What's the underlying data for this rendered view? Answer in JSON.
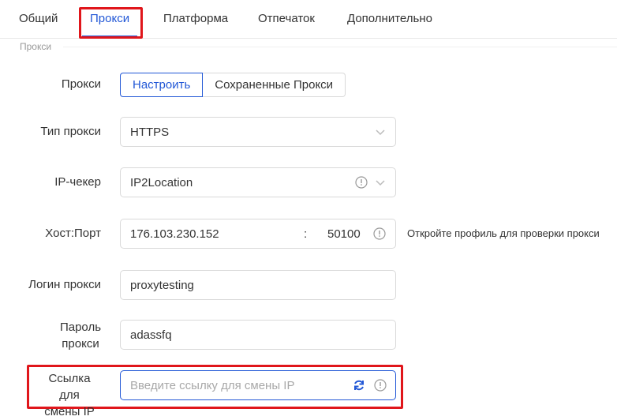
{
  "tabs": [
    {
      "label": "Общий"
    },
    {
      "label": "Прокси"
    },
    {
      "label": "Платформа"
    },
    {
      "label": "Отпечаток"
    },
    {
      "label": "Дополнительно"
    }
  ],
  "section_title": "Прокси",
  "proxy": {
    "label": "Прокси",
    "configure": "Настроить",
    "saved": "Сохраненные Прокси"
  },
  "proxy_type": {
    "label": "Тип прокси",
    "value": "HTTPS"
  },
  "ip_checker": {
    "label": "IP-чекер",
    "value": "IP2Location"
  },
  "host_port": {
    "label": "Хост:Порт",
    "host": "176.103.230.152",
    "separator": ":",
    "port": "50100",
    "hint": "Откройте профиль для проверки прокси"
  },
  "login": {
    "label": "Логин прокси",
    "value": "proxytesting"
  },
  "password": {
    "label_line1": "Пароль",
    "label_line2": "прокси",
    "value": "adassfq"
  },
  "change_ip": {
    "label_line1": "Ссылка для",
    "label_line2": "смены IP",
    "placeholder": "Введите ссылку для смены IP"
  },
  "colors": {
    "accent": "#2157d6",
    "highlight": "#e0161b",
    "border": "#d9d9d9"
  }
}
